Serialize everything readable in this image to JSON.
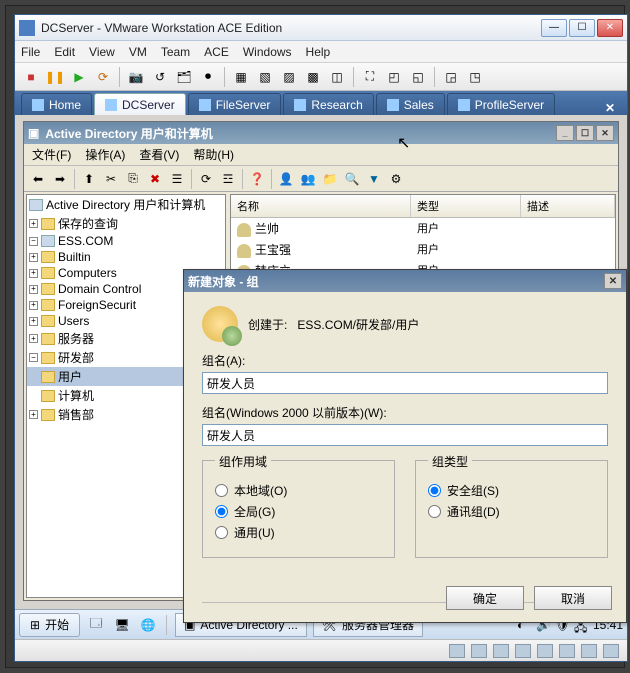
{
  "vmware": {
    "title": "DCServer - VMware Workstation ACE Edition",
    "menu": [
      "File",
      "Edit",
      "View",
      "VM",
      "Team",
      "ACE",
      "Windows",
      "Help"
    ],
    "tabs": [
      {
        "label": "Home"
      },
      {
        "label": "DCServer",
        "active": true
      },
      {
        "label": "FileServer"
      },
      {
        "label": "Research"
      },
      {
        "label": "Sales"
      },
      {
        "label": "ProfileServer"
      }
    ]
  },
  "ad": {
    "title": "Active Directory 用户和计算机",
    "menu": {
      "file": "文件(F)",
      "action": "操作(A)",
      "view": "查看(V)",
      "help": "帮助(H)"
    },
    "tree": {
      "root": "Active Directory 用户和计算机",
      "saved": "保存的查询",
      "domain": "ESS.COM",
      "builtin": "Builtin",
      "computers": "Computers",
      "dc": "Domain Control",
      "fsp": "ForeignSecurit",
      "users": "Users",
      "srv": "服务器",
      "rd": "研发部",
      "rd_users": "用户",
      "rd_comp": "计算机",
      "sales": "销售部"
    },
    "list": {
      "hdr": {
        "name": "名称",
        "type": "类型",
        "desc": "描述"
      },
      "rows": [
        {
          "name": "兰帅",
          "type": "用户"
        },
        {
          "name": "王宝强",
          "type": "用户"
        },
        {
          "name": "韩庆立",
          "type": "用户"
        }
      ]
    }
  },
  "dialog": {
    "title": "新建对象 - 组",
    "created_label": "创建于:",
    "created_value": "ESS.COM/研发部/用户",
    "name_label": "组名(A):",
    "name_value": "研发人员",
    "win2000_label": "组名(Windows 2000 以前版本)(W):",
    "win2000_value": "研发人员",
    "scope": {
      "legend": "组作用域",
      "local": "本地域(O)",
      "global": "全局(G)",
      "universal": "通用(U)"
    },
    "type": {
      "legend": "组类型",
      "security": "安全组(S)",
      "dist": "通讯组(D)"
    },
    "ok": "确定",
    "cancel": "取消"
  },
  "taskbar": {
    "start": "开始",
    "task1": "Active Directory ...",
    "task2": "服务器管理器",
    "time": "15:41"
  }
}
